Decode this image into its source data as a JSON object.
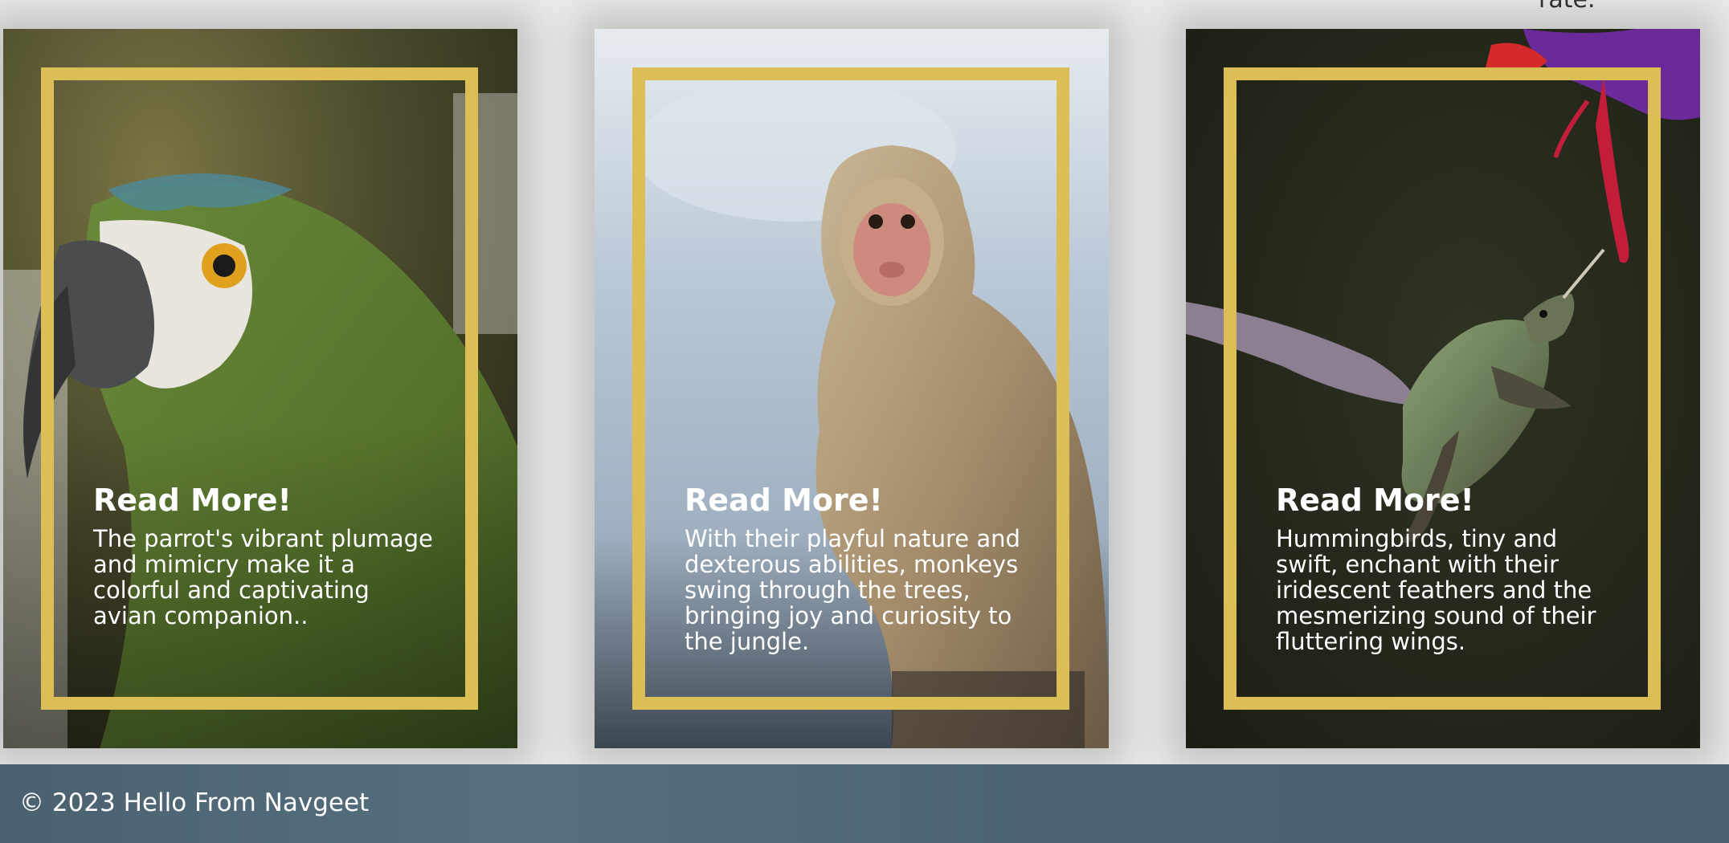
{
  "stray_text": "rate.",
  "cards": [
    {
      "heading": "Read More!",
      "body": "The parrot's vibrant plumage and mimicry make it a colorful and captivating avian companion..",
      "image": "parrot-photo"
    },
    {
      "heading": "Read More!",
      "body": "With their playful nature and dexterous abilities, monkeys swing through the trees, bringing joy and curiosity to the jungle.",
      "image": "monkey-photo"
    },
    {
      "heading": "Read More!",
      "body": "Hummingbirds, tiny and swift, enchant with their iridescent feathers and the mesmerizing sound of their fluttering wings.",
      "image": "hummingbird-photo"
    }
  ],
  "footer": {
    "text": "© 2023 Hello From Navgeet"
  },
  "colors": {
    "frame": "#dbbe55",
    "footer_bg": "#4c6472",
    "page_bg": "#ececea"
  }
}
